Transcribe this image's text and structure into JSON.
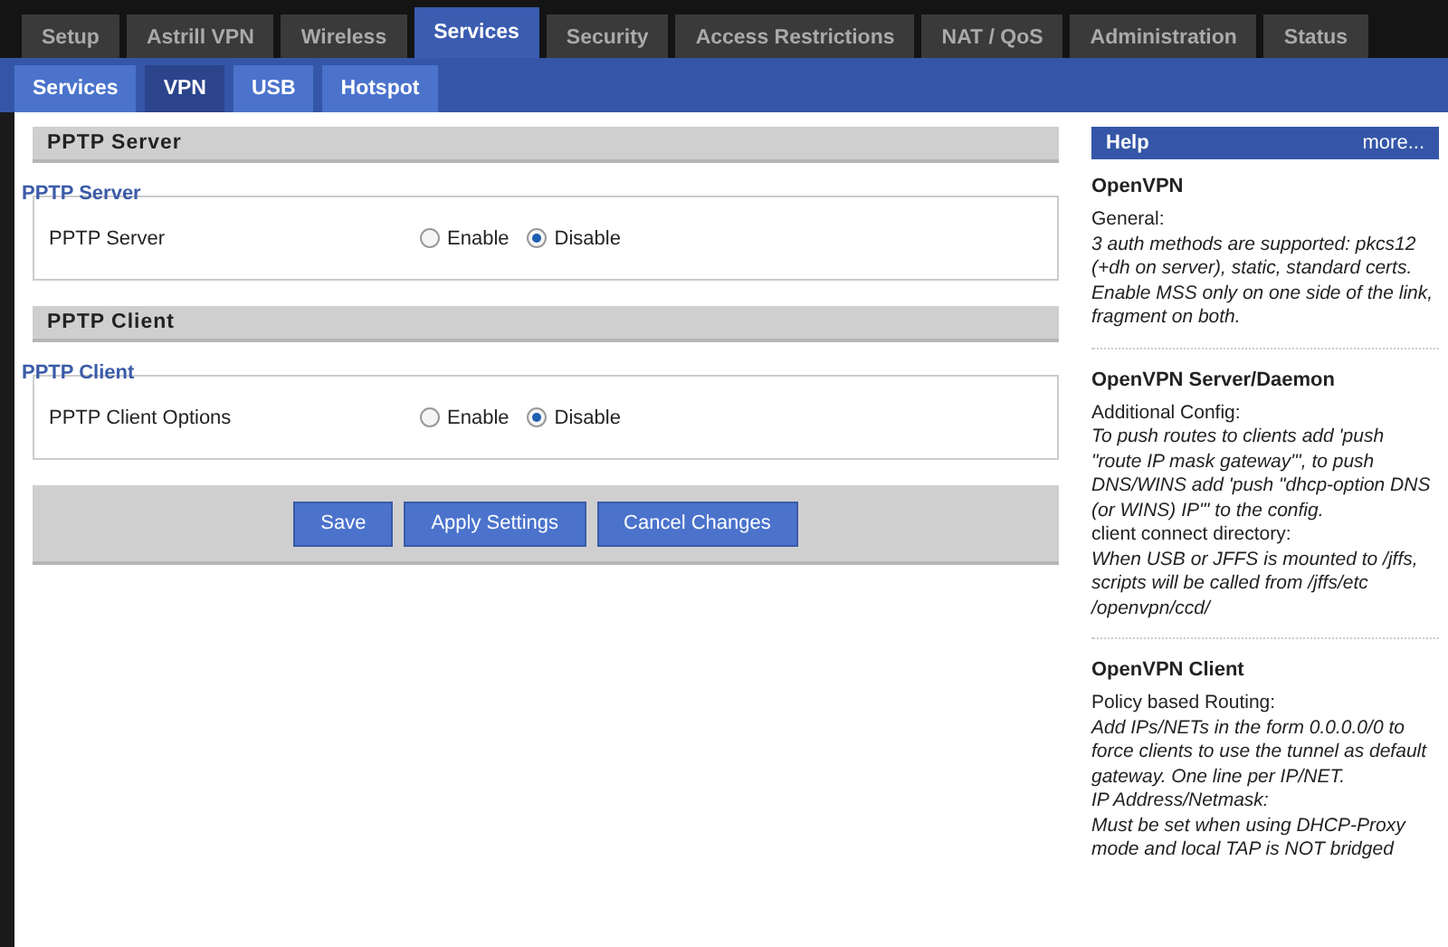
{
  "tabs": [
    {
      "label": "Setup",
      "selected": false
    },
    {
      "label": "Astrill VPN",
      "selected": false
    },
    {
      "label": "Wireless",
      "selected": false
    },
    {
      "label": "Services",
      "selected": true
    },
    {
      "label": "Security",
      "selected": false
    },
    {
      "label": "Access Restrictions",
      "selected": false
    },
    {
      "label": "NAT / QoS",
      "selected": false
    },
    {
      "label": "Administration",
      "selected": false
    },
    {
      "label": "Status",
      "selected": false
    }
  ],
  "subtabs": [
    {
      "label": "Services",
      "selected": false
    },
    {
      "label": "VPN",
      "selected": true
    },
    {
      "label": "USB",
      "selected": false
    },
    {
      "label": "Hotspot",
      "selected": false
    }
  ],
  "sections": [
    {
      "header": "PPTP Server",
      "legend": "PPTP Server",
      "setting": {
        "label": "PPTP Server",
        "options": [
          {
            "label": "Enable",
            "selected": false
          },
          {
            "label": "Disable",
            "selected": true
          }
        ]
      }
    },
    {
      "header": "PPTP Client",
      "legend": "PPTP Client",
      "setting": {
        "label": "PPTP Client Options",
        "options": [
          {
            "label": "Enable",
            "selected": false
          },
          {
            "label": "Disable",
            "selected": true
          }
        ]
      }
    }
  ],
  "buttons": [
    "Save",
    "Apply Settings",
    "Cancel Changes"
  ],
  "help": {
    "title": "Help",
    "more": "more...",
    "sections": [
      {
        "title": "OpenVPN",
        "items": [
          {
            "kind": "label",
            "text": "General:"
          },
          {
            "kind": "text",
            "text": "3 auth methods are supported: pkcs12 (+dh on server), static, standard certs. Enable MSS only on one side of the link, fragment on both."
          }
        ]
      },
      {
        "title": "OpenVPN Server/Daemon",
        "items": [
          {
            "kind": "label",
            "text": "Additional Config:"
          },
          {
            "kind": "text",
            "text": "To push routes to clients add 'push \"route IP mask gateway\"', to push DNS/WINS add 'push \"dhcp-option DNS (or WINS) IP\"' to the config."
          },
          {
            "kind": "label",
            "text": "client connect directory:"
          },
          {
            "kind": "text",
            "text": "When USB or JFFS is mounted to /jffs, scripts will be called from /jffs/etc /openvpn/ccd/"
          }
        ]
      },
      {
        "title": "OpenVPN Client",
        "items": [
          {
            "kind": "label",
            "text": "Policy based Routing:"
          },
          {
            "kind": "text",
            "text": "Add IPs/NETs in the form 0.0.0.0/0 to force clients to use the tunnel as default gateway. One line per IP/NET."
          },
          {
            "kind": "text",
            "text": "IP Address/Netmask:"
          },
          {
            "kind": "text",
            "text": "Must be set when using DHCP-Proxy mode and local TAP is NOT bridged"
          }
        ]
      }
    ]
  }
}
